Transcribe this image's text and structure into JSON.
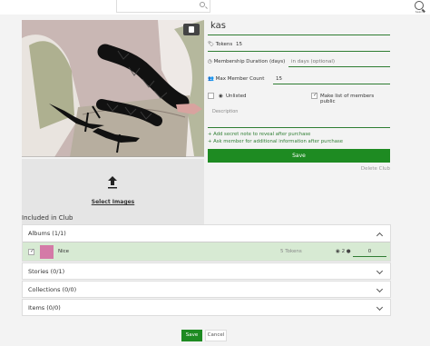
{
  "header": {
    "search_value": "",
    "icon_search_small": "search-icon",
    "icon_search_right": "search-icon",
    "search_label": "Search"
  },
  "club": {
    "name": "kas",
    "tokens_label": "Tokens",
    "tokens_value": "15",
    "duration_label": "Membership Duration (days)",
    "duration_placeholder": "in days (optional)",
    "max_member_label": "Max Member Count",
    "max_member_value": "15",
    "unlisted_label": "Unlisted",
    "public_label": "Make list of members public",
    "description_placeholder": "Description",
    "secret_note_link": "+ Add secret note to reveal after purchase",
    "ask_member_link": "+ Ask member for additional information after purchase",
    "save_label": "Save",
    "delete_label": "Delete Club",
    "select_images_label": "Select Images"
  },
  "included": {
    "title": "Included in Club",
    "sections": [
      {
        "label": "Albums (1/1)"
      },
      {
        "label": "Stories (0/1)"
      },
      {
        "label": "Collections (0/0)"
      },
      {
        "label": "Items (0/0)"
      }
    ],
    "album": {
      "name": "Nice",
      "tokens": "5 Tokens",
      "count": "2",
      "token_input_value": "0"
    }
  },
  "footer": {
    "save_label": "Save",
    "cancel_label": "Cancel"
  },
  "colors": {
    "accent": "#1e8b22",
    "selected_row": "#d7ead3"
  }
}
